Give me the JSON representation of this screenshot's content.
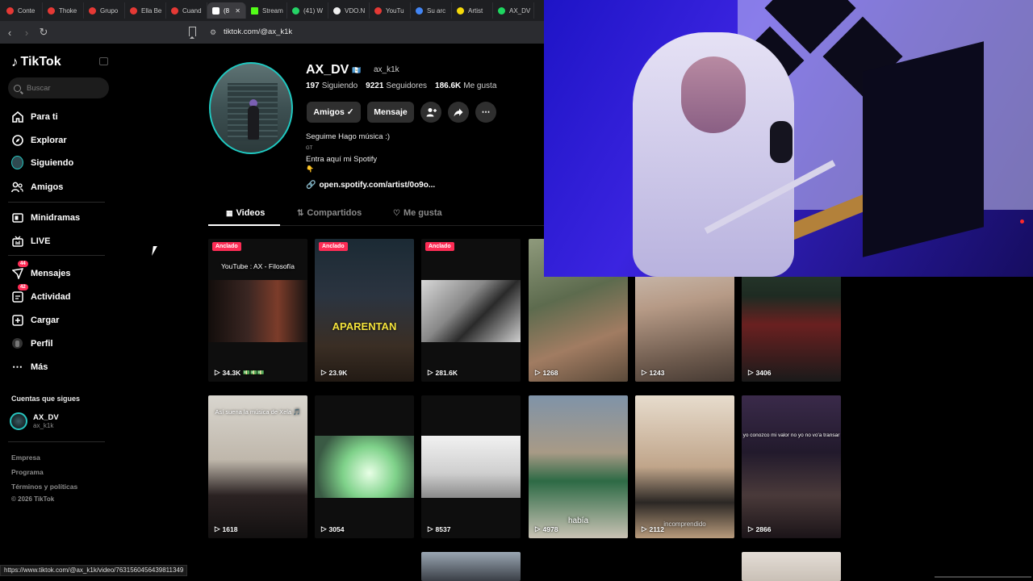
{
  "browser": {
    "tabs": [
      {
        "label": "Conte",
        "color": "#e53935"
      },
      {
        "label": "Thoke",
        "color": "#e53935"
      },
      {
        "label": "Grupo",
        "color": "#e53935"
      },
      {
        "label": "Ella Be",
        "color": "#e53935"
      },
      {
        "label": "Cuand",
        "color": "#e53935"
      },
      {
        "label": "(8",
        "color": "#ffffff",
        "active": true
      },
      {
        "label": "Stream",
        "color": "#53fc18"
      },
      {
        "label": "(41) W",
        "color": "#25d366"
      },
      {
        "label": "VDO.N",
        "color": "#eeeeee"
      },
      {
        "label": "YouTu",
        "color": "#e53935"
      },
      {
        "label": "Su arc",
        "color": "#4285f4"
      },
      {
        "label": "Artist",
        "color": "#f5d90a"
      },
      {
        "label": "AX_DV",
        "color": "#1ed760"
      }
    ],
    "url": "tiktok.com/@ax_k1k",
    "status_url": "https://www.tiktok.com/@ax_k1k/video/7631560456439811349"
  },
  "sidebar": {
    "logo": "TikTok",
    "search_placeholder": "Buscar",
    "items": [
      {
        "label": "Para ti",
        "icon": "home-icon"
      },
      {
        "label": "Explorar",
        "icon": "compass-icon"
      },
      {
        "label": "Siguiendo",
        "icon": "following-avatar"
      },
      {
        "label": "Amigos",
        "icon": "friends-icon"
      },
      {
        "label": "Minidramas",
        "icon": "minidramas-icon"
      },
      {
        "label": "LIVE",
        "icon": "live-icon"
      },
      {
        "label": "Mensajes",
        "icon": "messages-icon",
        "badge": "44"
      },
      {
        "label": "Actividad",
        "icon": "activity-icon",
        "badge": "42"
      },
      {
        "label": "Cargar",
        "icon": "upload-icon"
      },
      {
        "label": "Perfil",
        "icon": "profile-icon"
      },
      {
        "label": "Más",
        "icon": "more-icon"
      }
    ],
    "following_title": "Cuentas que sigues",
    "following": {
      "name": "AX_DV",
      "handle": "ax_k1k"
    },
    "footer": [
      "Empresa",
      "Programa",
      "Términos y políticas",
      "© 2026 TikTok"
    ]
  },
  "profile": {
    "name": "AX_DV",
    "handle": "ax_k1k",
    "stats": [
      {
        "value": "197",
        "label": "Siguiendo"
      },
      {
        "value": "9221",
        "label": "Seguidores"
      },
      {
        "value": "186.6K",
        "label": "Me gusta"
      }
    ],
    "buttons": {
      "friends": "Amigos ✓",
      "message": "Mensaje"
    },
    "bio": [
      "Seguime Hago música :)",
      "GT",
      "Entra aquí mi Spotify",
      "👇"
    ],
    "link": "open.spotify.com/artist/0o9o...",
    "tabs": [
      "Videos",
      "Compartidos",
      "Me gusta"
    ]
  },
  "videos": [
    {
      "views": "34.3K",
      "pinned": "Anclado",
      "caption": "YouTube : AX - Filosofía"
    },
    {
      "views": "23.9K",
      "pinned": "Anclado",
      "caption": "APARENTAN"
    },
    {
      "views": "281.6K",
      "pinned": "Anclado",
      "caption": ""
    },
    {
      "views": "1268",
      "caption": ""
    },
    {
      "views": "1243",
      "caption": ""
    },
    {
      "views": "3406",
      "caption": ""
    },
    {
      "views": "1618",
      "caption": "Así suena la música de Xela 🎵"
    },
    {
      "views": "3054",
      "caption": ""
    },
    {
      "views": "8537",
      "caption": ""
    },
    {
      "views": "4978",
      "caption": "había"
    },
    {
      "views": "2112",
      "caption": "incomprendido"
    },
    {
      "views": "2866",
      "caption": "yo conozco mi valor no yo no vo'a transar"
    }
  ],
  "colors": {
    "accent": "#fe2c55",
    "avatar_ring": "#1fc8c0",
    "background": "#000000"
  }
}
